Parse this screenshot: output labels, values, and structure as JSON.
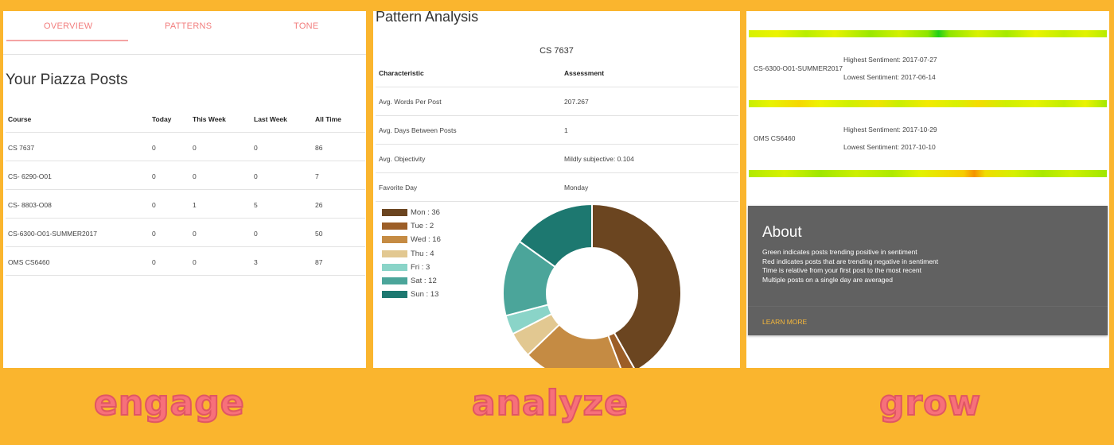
{
  "overview_panel": {
    "tabs": [
      "OVERVIEW",
      "PATTERNS",
      "TONE"
    ],
    "title": "Your Piazza Posts",
    "columns": [
      "Course",
      "Today",
      "This Week",
      "Last Week",
      "All Time"
    ],
    "rows": [
      [
        "CS 7637",
        "0",
        "0",
        "0",
        "86"
      ],
      [
        "CS- 6290-O01",
        "0",
        "0",
        "0",
        "7"
      ],
      [
        "CS- 8803-O08",
        "0",
        "1",
        "5",
        "26"
      ],
      [
        "CS-6300-O01-SUMMER2017",
        "0",
        "0",
        "0",
        "50"
      ],
      [
        "OMS CS6460",
        "0",
        "0",
        "3",
        "87"
      ]
    ]
  },
  "pattern_panel": {
    "title": "Pattern Analysis",
    "course": "CS 7637",
    "columns": [
      "Characteristic",
      "Assessment"
    ],
    "rows": [
      [
        "Avg. Words Per Post",
        "207.267"
      ],
      [
        "Avg. Days Between Posts",
        "1"
      ],
      [
        "Avg. Objectivity",
        "Mildly subjective: 0.104"
      ],
      [
        "Favorite Day",
        "Monday"
      ]
    ],
    "legend": [
      {
        "label": "Mon : 36",
        "color": "#6B4520"
      },
      {
        "label": "Tue : 2",
        "color": "#9C5E27"
      },
      {
        "label": "Wed : 16",
        "color": "#C58B43"
      },
      {
        "label": "Thu : 4",
        "color": "#E2C891"
      },
      {
        "label": "Fri : 3",
        "color": "#8AD4C8"
      },
      {
        "label": "Sat : 12",
        "color": "#4BA59A"
      },
      {
        "label": "Sun : 13",
        "color": "#1D7870"
      }
    ]
  },
  "chart_data": {
    "type": "pie",
    "donut": true,
    "categories": [
      "Mon",
      "Tue",
      "Wed",
      "Thu",
      "Fri",
      "Sat",
      "Sun"
    ],
    "values": [
      36,
      2,
      16,
      4,
      3,
      12,
      13
    ],
    "colors": [
      "#6B4520",
      "#9C5E27",
      "#C58B43",
      "#E2C891",
      "#8AD4C8",
      "#4BA59A",
      "#1D7870"
    ],
    "legend": "left"
  },
  "tone_panel": {
    "sentiment": [
      {
        "course": "CS-6300-O01-SUMMER2017",
        "highest": "Highest Sentiment: 2017-07-27",
        "lowest": "Lowest Sentiment: 2017-06-14"
      },
      {
        "course": "OMS CS6460",
        "highest": "Highest Sentiment: 2017-10-29",
        "lowest": "Lowest Sentiment: 2017-10-10"
      }
    ],
    "about": {
      "title": "About",
      "lines": [
        "Green indicates posts trending positive in sentiment",
        "Red indicates posts that are trending negative in sentiment",
        "Time is relative from your first post to the most recent",
        "Multiple posts on a single day are averaged"
      ],
      "link": "LEARN MORE"
    }
  },
  "footer": {
    "words": [
      "engage",
      "analyze",
      "grow"
    ]
  }
}
